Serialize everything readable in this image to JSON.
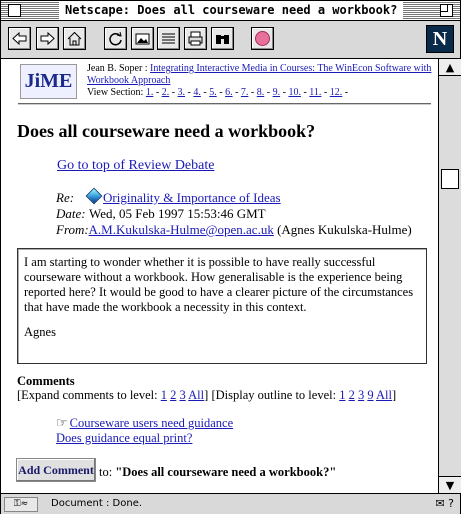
{
  "window": {
    "title": "Netscape: Does all courseware need a workbook?"
  },
  "toolbar": {
    "buttons": [
      {
        "name": "back",
        "icon": "arrow-left-icon"
      },
      {
        "name": "forward",
        "icon": "arrow-right-icon"
      },
      {
        "name": "home",
        "icon": "home-icon"
      },
      {
        "name": "reload",
        "icon": "reload-icon"
      },
      {
        "name": "images",
        "icon": "images-icon"
      },
      {
        "name": "open",
        "icon": "open-icon"
      },
      {
        "name": "print",
        "icon": "print-icon"
      },
      {
        "name": "find",
        "icon": "find-icon"
      },
      {
        "name": "stop",
        "icon": "stop-icon"
      }
    ],
    "logo": "N"
  },
  "header": {
    "logo_text": "JiME",
    "author": "Jean B. Soper :",
    "article_link": "Integrating Interactive Media in Courses: The WinEcon Software with Workbook Approach",
    "view_section_label": "View Section:",
    "sections": [
      "1.",
      "2.",
      "3.",
      "4.",
      "5.",
      "6.",
      "7.",
      "8.",
      "9.",
      "10.",
      "11.",
      "12."
    ]
  },
  "page": {
    "heading": "Does all courseware need a workbook?",
    "goto_link": "Go to top of Review Debate"
  },
  "meta": {
    "re_label": "Re:",
    "re_link": "Originality & Importance of Ideas",
    "date_label": "Date:",
    "date_value": "Wed, 05 Feb 1997 15:53:46 GMT",
    "from_label": "From:",
    "from_email": "A.M.Kukulska-Hulme@open.ac.uk",
    "from_name": "(Agnes Kukulska-Hulme)"
  },
  "message": {
    "body": "I am starting to wonder whether it is possible to have really successful courseware without a workbook. How generalisable is the experience being reported here? It would be good to have a clearer picture of the circumstances that have made the workbook a necessity in this context.",
    "signature": "Agnes"
  },
  "comments": {
    "title": "Comments",
    "expand_label": "[Expand comments to level:",
    "expand_levels": [
      "1",
      "2",
      "3",
      "All"
    ],
    "display_label": "[Display outline to level:",
    "display_levels": [
      "1",
      "2",
      "3",
      "9",
      "All"
    ],
    "threads": [
      "Courseware users need guidance",
      "Does guidance equal print?"
    ],
    "add_button": "Add Comment",
    "to_label": "to:",
    "to_title": "\"Does all courseware need a workbook?\""
  },
  "status": {
    "text": "Document : Done."
  }
}
